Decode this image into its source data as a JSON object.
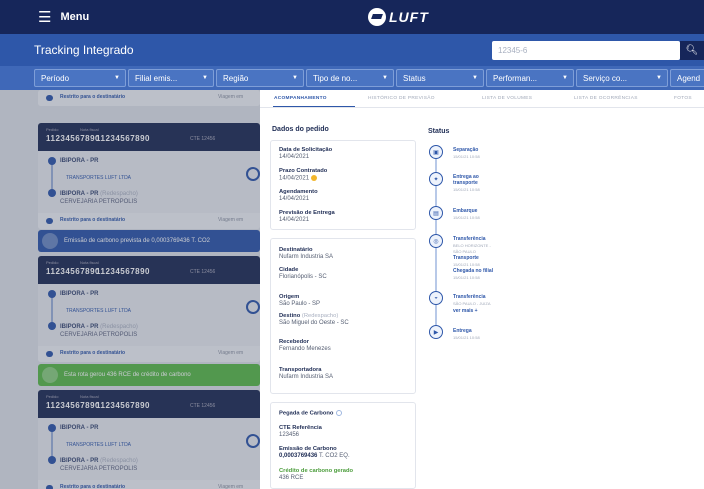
{
  "topbar": {
    "menu_label": "Menu",
    "logo_text": "LUFT"
  },
  "header": {
    "title": "Tracking Integrado",
    "search_value": "12345-6"
  },
  "filters": [
    "Período",
    "Filial emis...",
    "Região",
    "Tipo de no...",
    "Status",
    "Performan...",
    "Serviço co...",
    "Agend"
  ],
  "list": {
    "card": {
      "pedido_label": "Pedido",
      "nf_label": "Nota fiscal",
      "pedido_number": "11234567890",
      "nf_number": "11234567890",
      "cte": "CTE 12456",
      "origin": "IBIPORA - PR",
      "carrier": "TRANSPORTES LUFT LTDA",
      "destination": "IBIPORA - PR",
      "destination_tag": "(Redespacho)",
      "recipient": "CERVEJARIA PETROPOLIS",
      "footer": "Restrito para o destinatário",
      "footer_right": "Viagem em"
    },
    "banner_carbon": "Emissão de carbono prevista de 0,0003769436 T. CO2",
    "banner_credit": "Esta rota gerou 436 RCE de crédito de carbono"
  },
  "detail": {
    "tabs": [
      "ACOMPANHAMENTO",
      "HISTÓRICO DE PREVISÃO",
      "LISTA DE VOLUMES",
      "LISTA DE OCORRÊNCIAS",
      "FOTOS"
    ],
    "order_title": "Dados do pedido",
    "dates": [
      {
        "label": "Data de Solicitação",
        "value": "14/04/2021"
      },
      {
        "label": "Prazo Contratado",
        "value": "14/04/2021"
      },
      {
        "label": "Agendamento",
        "value": "14/04/2021"
      },
      {
        "label": "Previsão de Entrega",
        "value": "14/04/2021"
      }
    ],
    "destinatario": {
      "label": "Destinatário",
      "value": "Nufarm Industria SA"
    },
    "cidade": {
      "label": "Cidade",
      "value": "Florianópolis - SC"
    },
    "origem": {
      "label": "Origem",
      "value": "São Paulo - SP"
    },
    "destino": {
      "label": "Destino",
      "tag": "(Redespacho)",
      "value": "São Miguel do Oeste - SC"
    },
    "recebedor": {
      "label": "Recebedor",
      "value": "Fernando Menezes"
    },
    "transportadora": {
      "label": "Transportadora",
      "value": "Nufarm Industria SA"
    },
    "carbon": {
      "title": "Pegada de Carbono",
      "cte_label": "CTE Referência",
      "cte_value": "123456",
      "emission_label": "Emissão de Carbono",
      "emission_value": "0,0003769436",
      "emission_unit": "T. CO2 EQ.",
      "credit_label": "Crédito de carbono gerado",
      "credit_value": "436 RCE"
    },
    "status_title": "Status",
    "status": [
      {
        "title": "Separação",
        "sub": "15/01/21 10:58"
      },
      {
        "title": "Entrega ao",
        "title2": "transporte",
        "sub": "15/01/21 10:58"
      },
      {
        "title": "Embarque",
        "sub": "15/01/21 10:58"
      },
      {
        "title": "Transferência",
        "sub": "BELO HORIZONTE -",
        "sub2": "SÃO PAULO",
        "extra1": "Transporte",
        "extra1_sub": "15/01/21 10:58",
        "extra2": "Chegada no filial",
        "extra2_sub": "15/01/21 10:58"
      },
      {
        "title": "Transferência",
        "sub": "SÃO PAULO - JUIZA",
        "extra1": "ver mais +"
      },
      {
        "title": "Entrega",
        "sub": "15/01/21 10:58"
      }
    ]
  },
  "colors": {
    "navy": "#16265a",
    "blue": "#2e57a9",
    "green": "#5ab94a",
    "clock": "#f2b62c"
  }
}
